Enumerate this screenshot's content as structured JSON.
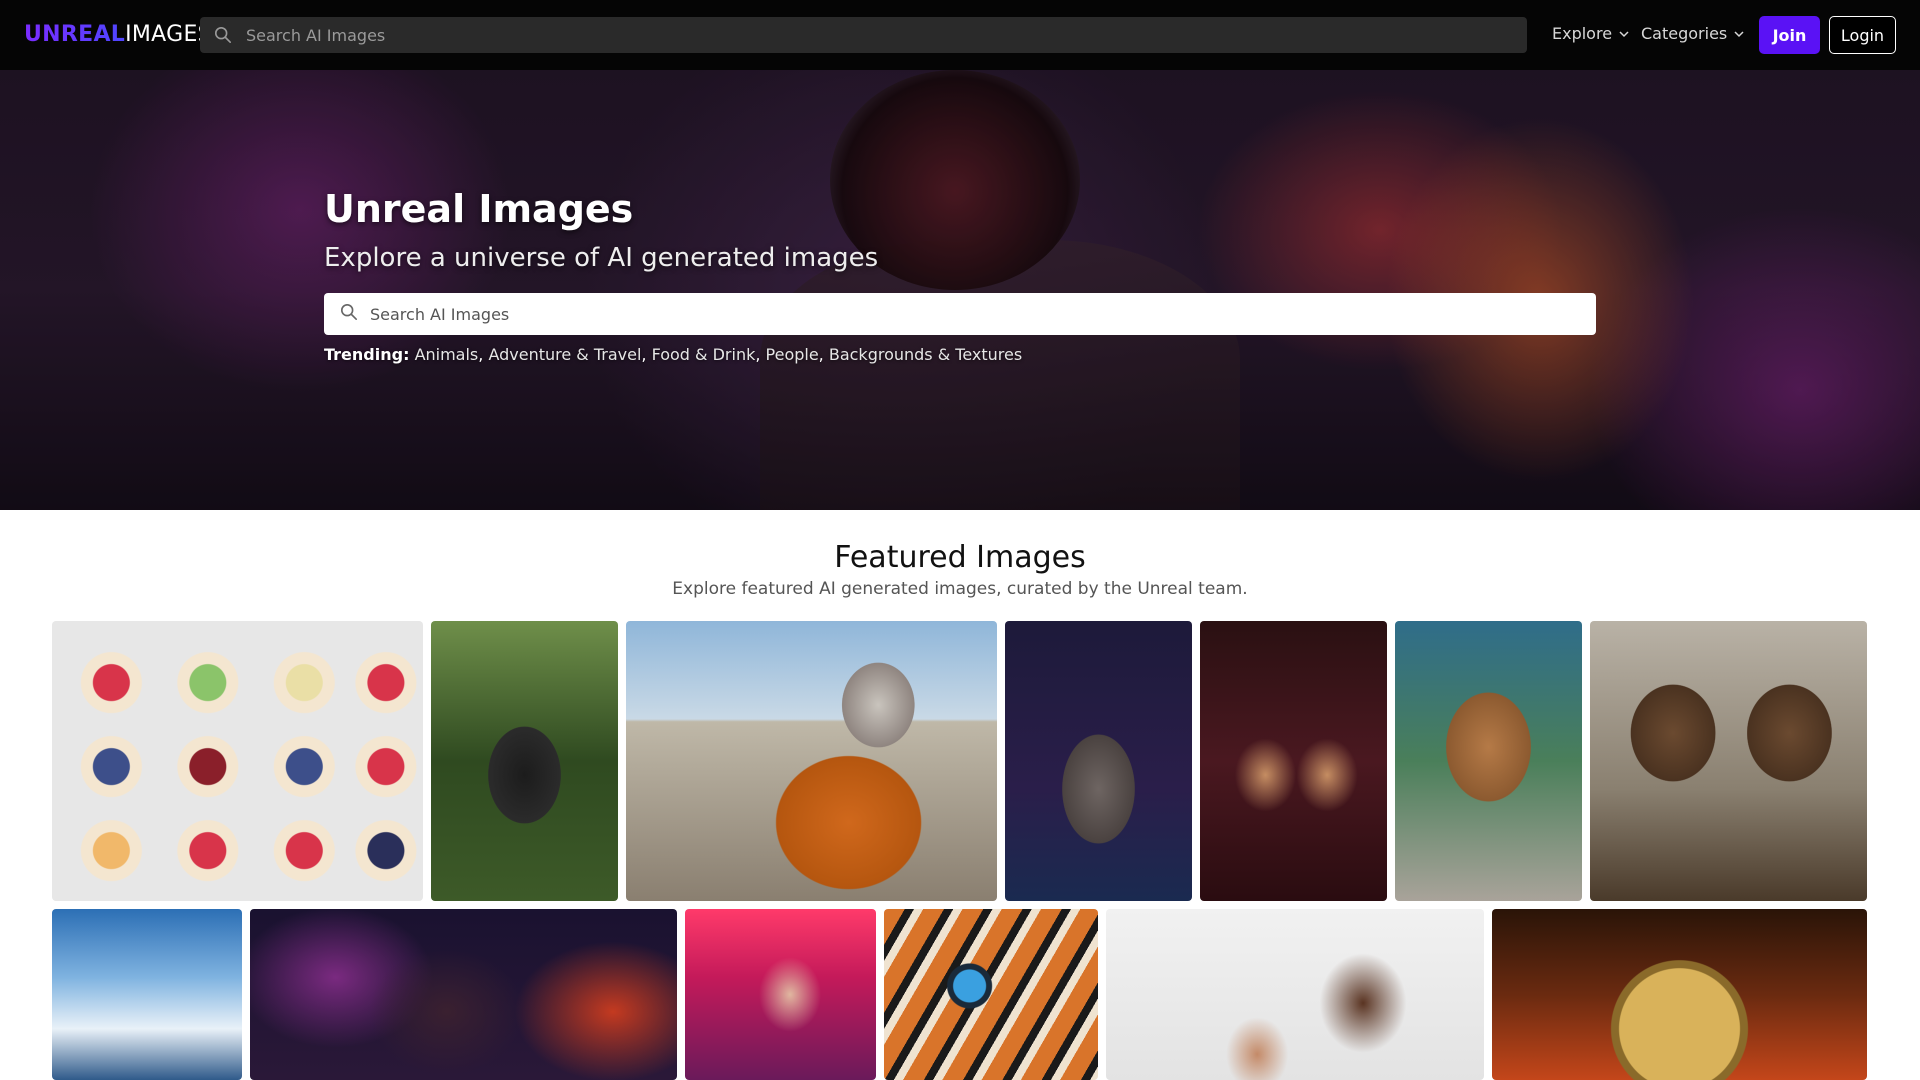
{
  "nav": {
    "logo_part1": "UNREAL",
    "logo_part2": "IMAGES",
    "search_placeholder": "Search AI Images",
    "explore_label": "Explore",
    "categories_label": "Categories",
    "join_label": "Join",
    "login_label": "Login"
  },
  "hero": {
    "title": "Unreal Images",
    "subtitle": "Explore a universe of AI generated images",
    "search_placeholder": "Search AI Images",
    "trending_label": "Trending:",
    "trending_items": [
      "Animals",
      "Adventure & Travel",
      "Food & Drink",
      "People",
      "Backgrounds & Textures"
    ]
  },
  "featured": {
    "title": "Featured Images",
    "subtitle": "Explore featured AI generated images, curated by the Unreal team."
  },
  "colors": {
    "nav_bg": "#050505",
    "join_button": "#5a12f5",
    "logo_gradient_start": "#7b2cff",
    "logo_gradient_end": "#4f46ff"
  },
  "icons": {
    "search": "search-icon",
    "chevron": "chevron-down-icon"
  }
}
